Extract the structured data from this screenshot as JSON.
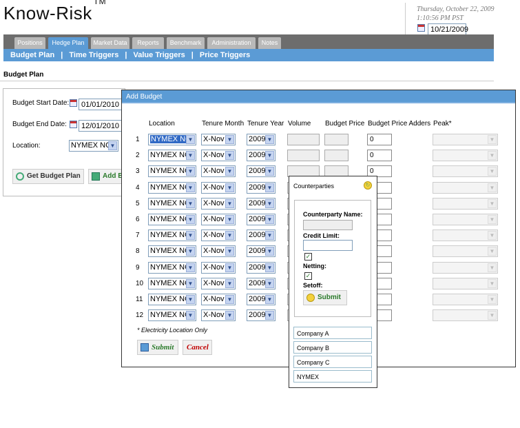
{
  "app": {
    "title": "Know-Risk",
    "trademark": "TM"
  },
  "header": {
    "date_line": "Thursday, October 22, 2009",
    "time_line": "1:10:56 PM PST",
    "date_value": "10/21/2009"
  },
  "tabs": [
    "Positions",
    "Hedge Plan",
    "Market Data",
    "Reports",
    "Benchmark",
    "Administration",
    "Notes"
  ],
  "subnav": [
    "Budget Plan",
    "|",
    "Time Triggers",
    "|",
    "Value Triggers",
    "|",
    "Price Triggers"
  ],
  "page_title": "Budget Plan",
  "left_panel": {
    "start_label": "Budget Start Date:",
    "start_value": "01/01/2010",
    "end_label": "Budget End Date:",
    "end_value": "12/01/2010",
    "location_label": "Location:",
    "location_value": "NYMEX NG",
    "get_button": "Get Budget Plan",
    "add_button": "Add Bu"
  },
  "add_budget": {
    "title": "Add Budget",
    "columns": [
      "Location",
      "Tenure Month",
      "Tenure Year",
      "Volume",
      "Budget Price",
      "Budget Price Adders",
      "Peak*"
    ],
    "rows": [
      {
        "n": "1",
        "location": "NYMEX NG",
        "month": "X-Nov",
        "year": "2009",
        "adders": "0"
      },
      {
        "n": "2",
        "location": "NYMEX NG",
        "month": "X-Nov",
        "year": "2009",
        "adders": "0"
      },
      {
        "n": "3",
        "location": "NYMEX NG",
        "month": "X-Nov",
        "year": "2009",
        "adders": "0"
      },
      {
        "n": "4",
        "location": "NYMEX NG",
        "month": "X-Nov",
        "year": "2009",
        "adders": ""
      },
      {
        "n": "5",
        "location": "NYMEX NG",
        "month": "X-Nov",
        "year": "2009",
        "adders": ""
      },
      {
        "n": "6",
        "location": "NYMEX NG",
        "month": "X-Nov",
        "year": "2009",
        "adders": ""
      },
      {
        "n": "7",
        "location": "NYMEX NG",
        "month": "X-Nov",
        "year": "2009",
        "adders": ""
      },
      {
        "n": "8",
        "location": "NYMEX NG",
        "month": "X-Nov",
        "year": "2009",
        "adders": ""
      },
      {
        "n": "9",
        "location": "NYMEX NG",
        "month": "X-Nov",
        "year": "2009",
        "adders": ""
      },
      {
        "n": "10",
        "location": "NYMEX NG",
        "month": "X-Nov",
        "year": "2009",
        "adders": ""
      },
      {
        "n": "11",
        "location": "NYMEX NG",
        "month": "X-Nov",
        "year": "2009",
        "adders": ""
      },
      {
        "n": "12",
        "location": "NYMEX NG",
        "month": "X-Nov",
        "year": "2009",
        "adders": ""
      }
    ],
    "footnote": "* Electricity Location Only",
    "submit": "Submit",
    "cancel": "Cancel"
  },
  "counterparties": {
    "title": "Counterparties",
    "name_label": "Counterparty Name:",
    "credit_label": "Credit Limit:",
    "netting_label": "Netting:",
    "setoff_label": "Setoff:",
    "submit": "Submit",
    "companies": [
      "Company A",
      "Company B",
      "Company C",
      "NYMEX"
    ]
  },
  "colors": {
    "accent": "#5b9bd5",
    "tabbar": "#6d6d6d",
    "submit_green": "#2a7a2a",
    "cancel_red": "#c00000"
  },
  "icons": [
    "calendar-icon",
    "search-icon",
    "add-icon",
    "submit-icon",
    "cancel-icon",
    "close-icon",
    "dropdown-arrow-icon"
  ]
}
